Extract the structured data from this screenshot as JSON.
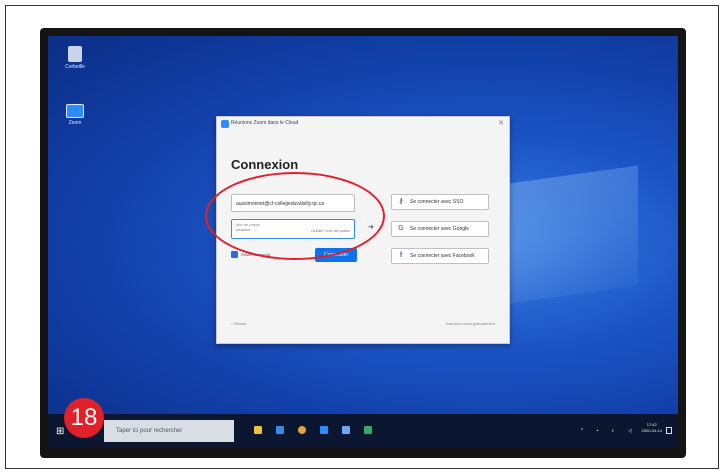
{
  "desktop": {
    "icons": [
      {
        "label": "Corbeille"
      },
      {
        "label": "Zoom"
      }
    ]
  },
  "dialog": {
    "title": "Réunions Zoom dans le Cloud",
    "heading": "Connexion",
    "email_value": "aussimonnet@cf-collegeduvalsilly.qc.ca",
    "password_label": "Mot de passe",
    "password_value": "••••••••••",
    "forgot_label": "Oublié? mot de passe",
    "remember_label": "Rester connecté",
    "login_button": "Connexion",
    "sso_label": "Se connecter avec SSO",
    "google_label": "Se connecter avec Google",
    "facebook_label": "Se connecter avec Facebook",
    "back_label": "< Retour",
    "signup_label": "Inscrivez-vous gratuitement"
  },
  "taskbar": {
    "search_placeholder": "Taper ici pour rechercher",
    "time": "17:42",
    "date": "2020-04-14"
  },
  "step_badge": "18",
  "colors": {
    "accent": "#0e72ed",
    "annotation": "#e0212a"
  }
}
